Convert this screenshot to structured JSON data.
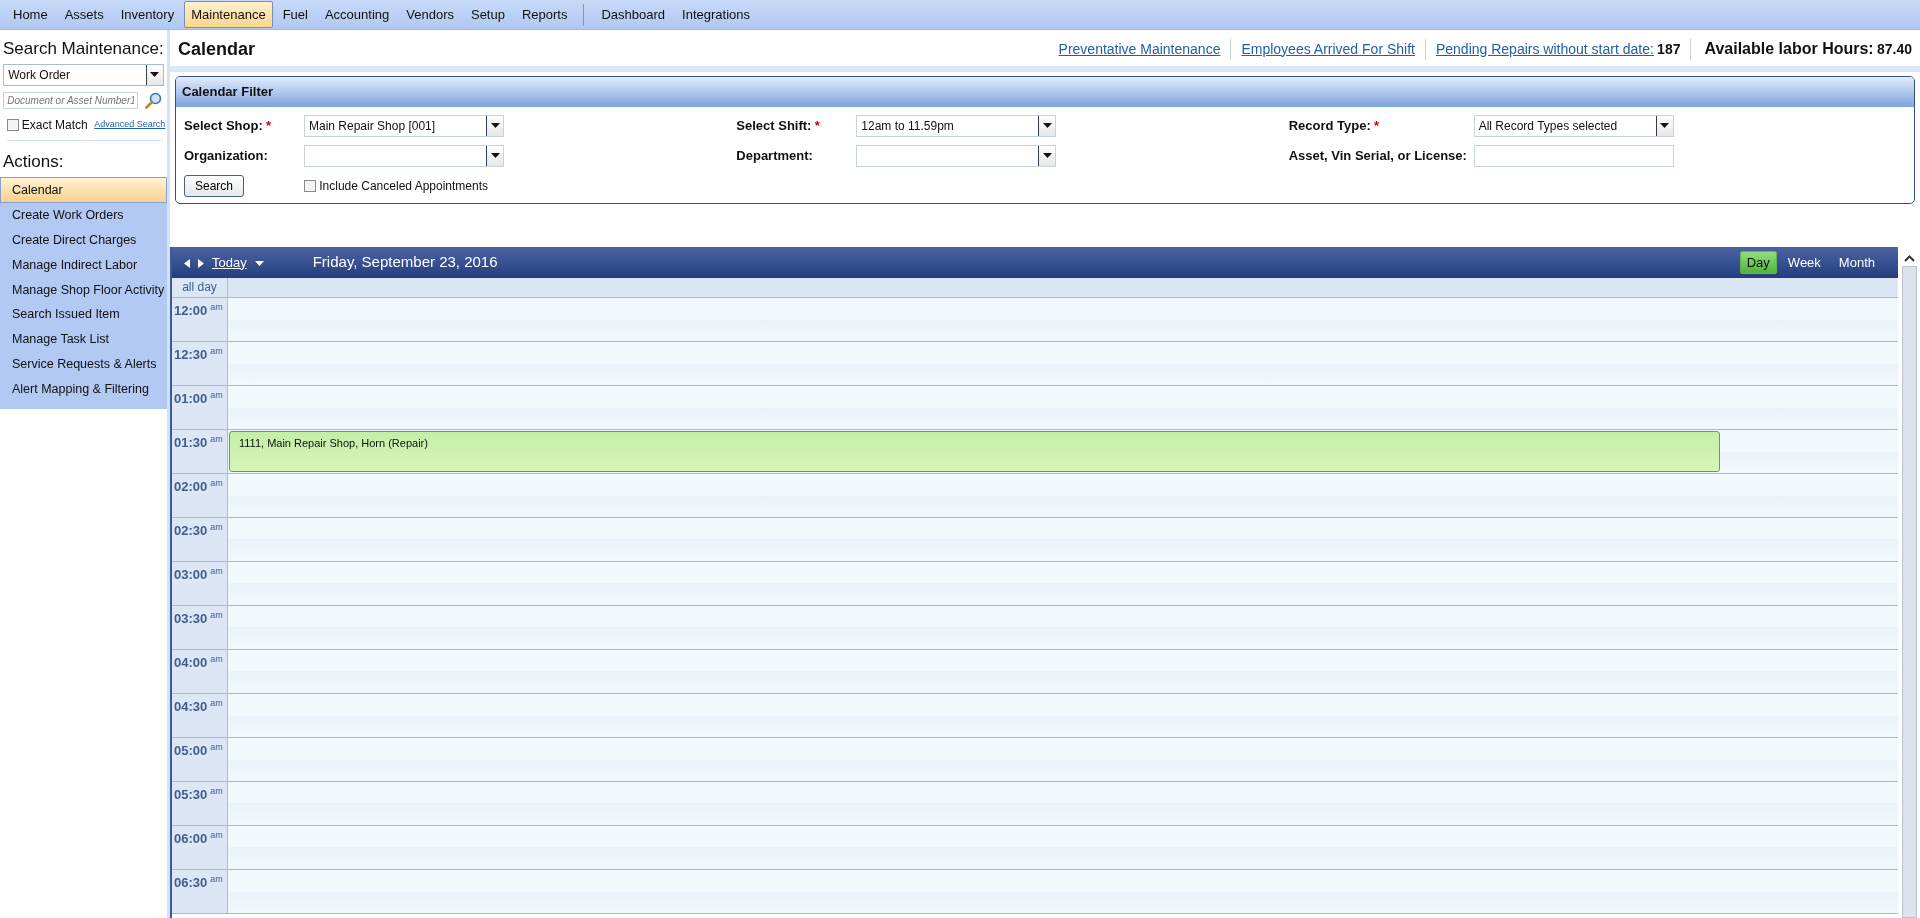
{
  "menu": {
    "main": [
      {
        "label": "Home",
        "selected": false
      },
      {
        "label": "Assets",
        "selected": false
      },
      {
        "label": "Inventory",
        "selected": false
      },
      {
        "label": "Maintenance",
        "selected": true
      },
      {
        "label": "Fuel",
        "selected": false
      },
      {
        "label": "Accounting",
        "selected": false
      },
      {
        "label": "Vendors",
        "selected": false
      },
      {
        "label": "Setup",
        "selected": false
      },
      {
        "label": "Reports",
        "selected": false
      }
    ],
    "secondary": [
      {
        "label": "Dashboard",
        "selected": false
      },
      {
        "label": "Integrations",
        "selected": false
      }
    ]
  },
  "sidebar": {
    "search_title": "Search Maintenance:",
    "search_type": "Work Order",
    "search_field": {
      "placeholder": "Document or Asset Number1"
    },
    "exact_match": {
      "label": "Exact Match",
      "checked": false
    },
    "advanced_search": "Advanced Search",
    "actions_title": "Actions:",
    "actions": [
      {
        "label": "Calendar",
        "selected": true
      },
      {
        "label": "Create Work Orders",
        "selected": false
      },
      {
        "label": "Create Direct Charges",
        "selected": false
      },
      {
        "label": "Manage Indirect Labor",
        "selected": false
      },
      {
        "label": "Manage Shop Floor Activity",
        "selected": false
      },
      {
        "label": "Search Issued Item",
        "selected": false
      },
      {
        "label": "Manage Task List",
        "selected": false
      },
      {
        "label": "Service Requests & Alerts",
        "selected": false
      },
      {
        "label": "Alert Mapping & Filtering",
        "selected": false
      }
    ]
  },
  "header": {
    "title": "Calendar",
    "links": [
      "Preventative Maintenance",
      "Employees Arrived For Shift",
      "Pending Repairs without start date:"
    ],
    "pending_count": "187",
    "labor_label": "Available labor Hours:",
    "labor_value": "87.40"
  },
  "filter": {
    "title": "Calendar Filter",
    "fields": [
      {
        "label": "Select Shop:",
        "required": "*",
        "kind": "select",
        "value": "Main Repair Shop [001]"
      },
      {
        "label": "Select Shift:",
        "required": "*",
        "kind": "select",
        "value": "12am to 11.59pm"
      },
      {
        "label": "Record Type:",
        "required": "*",
        "kind": "select",
        "value": "All Record Types selected"
      },
      {
        "label": "Organization:",
        "kind": "select"
      },
      {
        "label": "Department:",
        "kind": "select"
      },
      {
        "label": "Asset, Vin Serial, or License:",
        "kind": "text"
      }
    ],
    "search_button": "Search",
    "include_canceled": {
      "label": "Include Canceled Appointments",
      "checked": false
    }
  },
  "calendar": {
    "today": "Today",
    "date": "Friday, September 23, 2016",
    "views": [
      {
        "label": "Day",
        "selected": true
      },
      {
        "label": "Week",
        "selected": false
      },
      {
        "label": "Month",
        "selected": false
      }
    ],
    "all_day": "all day",
    "slots": [
      {
        "time": "12:00",
        "suffix": "am"
      },
      {
        "time": "12:30",
        "suffix": "am"
      },
      {
        "time": "01:00",
        "suffix": "am"
      },
      {
        "time": "01:30",
        "suffix": "am",
        "events": [
          {
            "text": "1111, Main Repair Shop, Horn (Repair)"
          }
        ]
      },
      {
        "time": "02:00",
        "suffix": "am"
      },
      {
        "time": "02:30",
        "suffix": "am"
      },
      {
        "time": "03:00",
        "suffix": "am"
      },
      {
        "time": "03:30",
        "suffix": "am"
      },
      {
        "time": "04:00",
        "suffix": "am"
      },
      {
        "time": "04:30",
        "suffix": "am"
      },
      {
        "time": "05:00",
        "suffix": "am"
      },
      {
        "time": "05:30",
        "suffix": "am"
      },
      {
        "time": "06:00",
        "suffix": "am"
      },
      {
        "time": "06:30",
        "suffix": "am"
      }
    ]
  }
}
